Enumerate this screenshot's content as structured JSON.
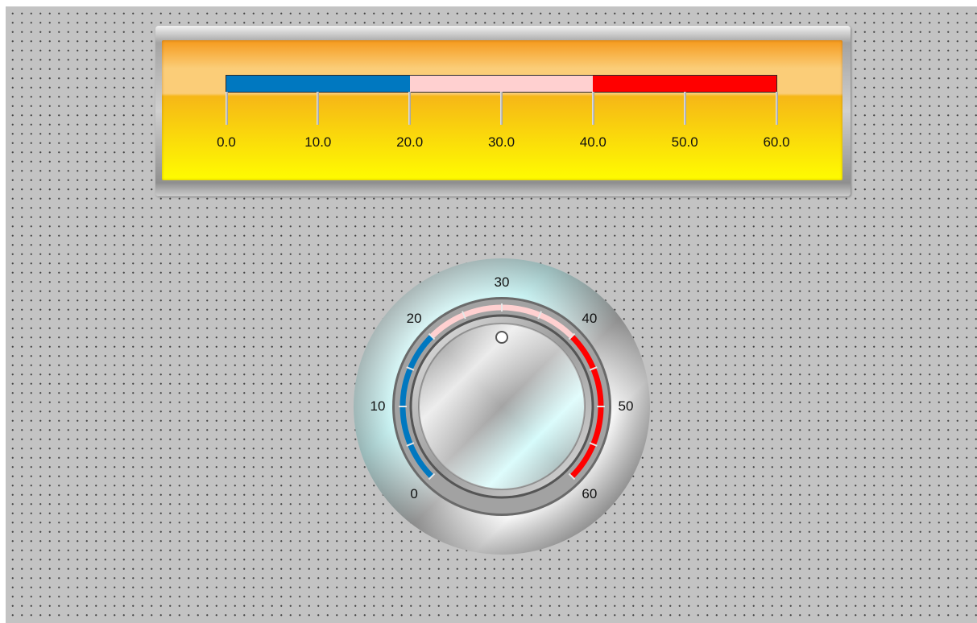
{
  "linear_scale": {
    "ticks": [
      "0.0",
      "10.0",
      "20.0",
      "30.0",
      "40.0",
      "50.0",
      "60.0"
    ],
    "min": 0,
    "max": 60,
    "ranges": [
      {
        "from": 0,
        "to": 20,
        "color": "#0078c0"
      },
      {
        "from": 20,
        "to": 40,
        "color": "#ffd0d0"
      },
      {
        "from": 40,
        "to": 60,
        "color": "#ff0000"
      }
    ],
    "panel_color_top": "#f59a1c",
    "panel_color_bottom": "#fffc00"
  },
  "rotary_knob": {
    "scale_labels": [
      "0",
      "10",
      "20",
      "30",
      "40",
      "50",
      "60"
    ],
    "min": 0,
    "max": 60,
    "value": 30,
    "ranges": [
      {
        "from": 0,
        "to": 20,
        "color": "#0078c0"
      },
      {
        "from": 20,
        "to": 40,
        "color": "#ffd0d0"
      },
      {
        "from": 40,
        "to": 60,
        "color": "#ff0000"
      }
    ]
  }
}
